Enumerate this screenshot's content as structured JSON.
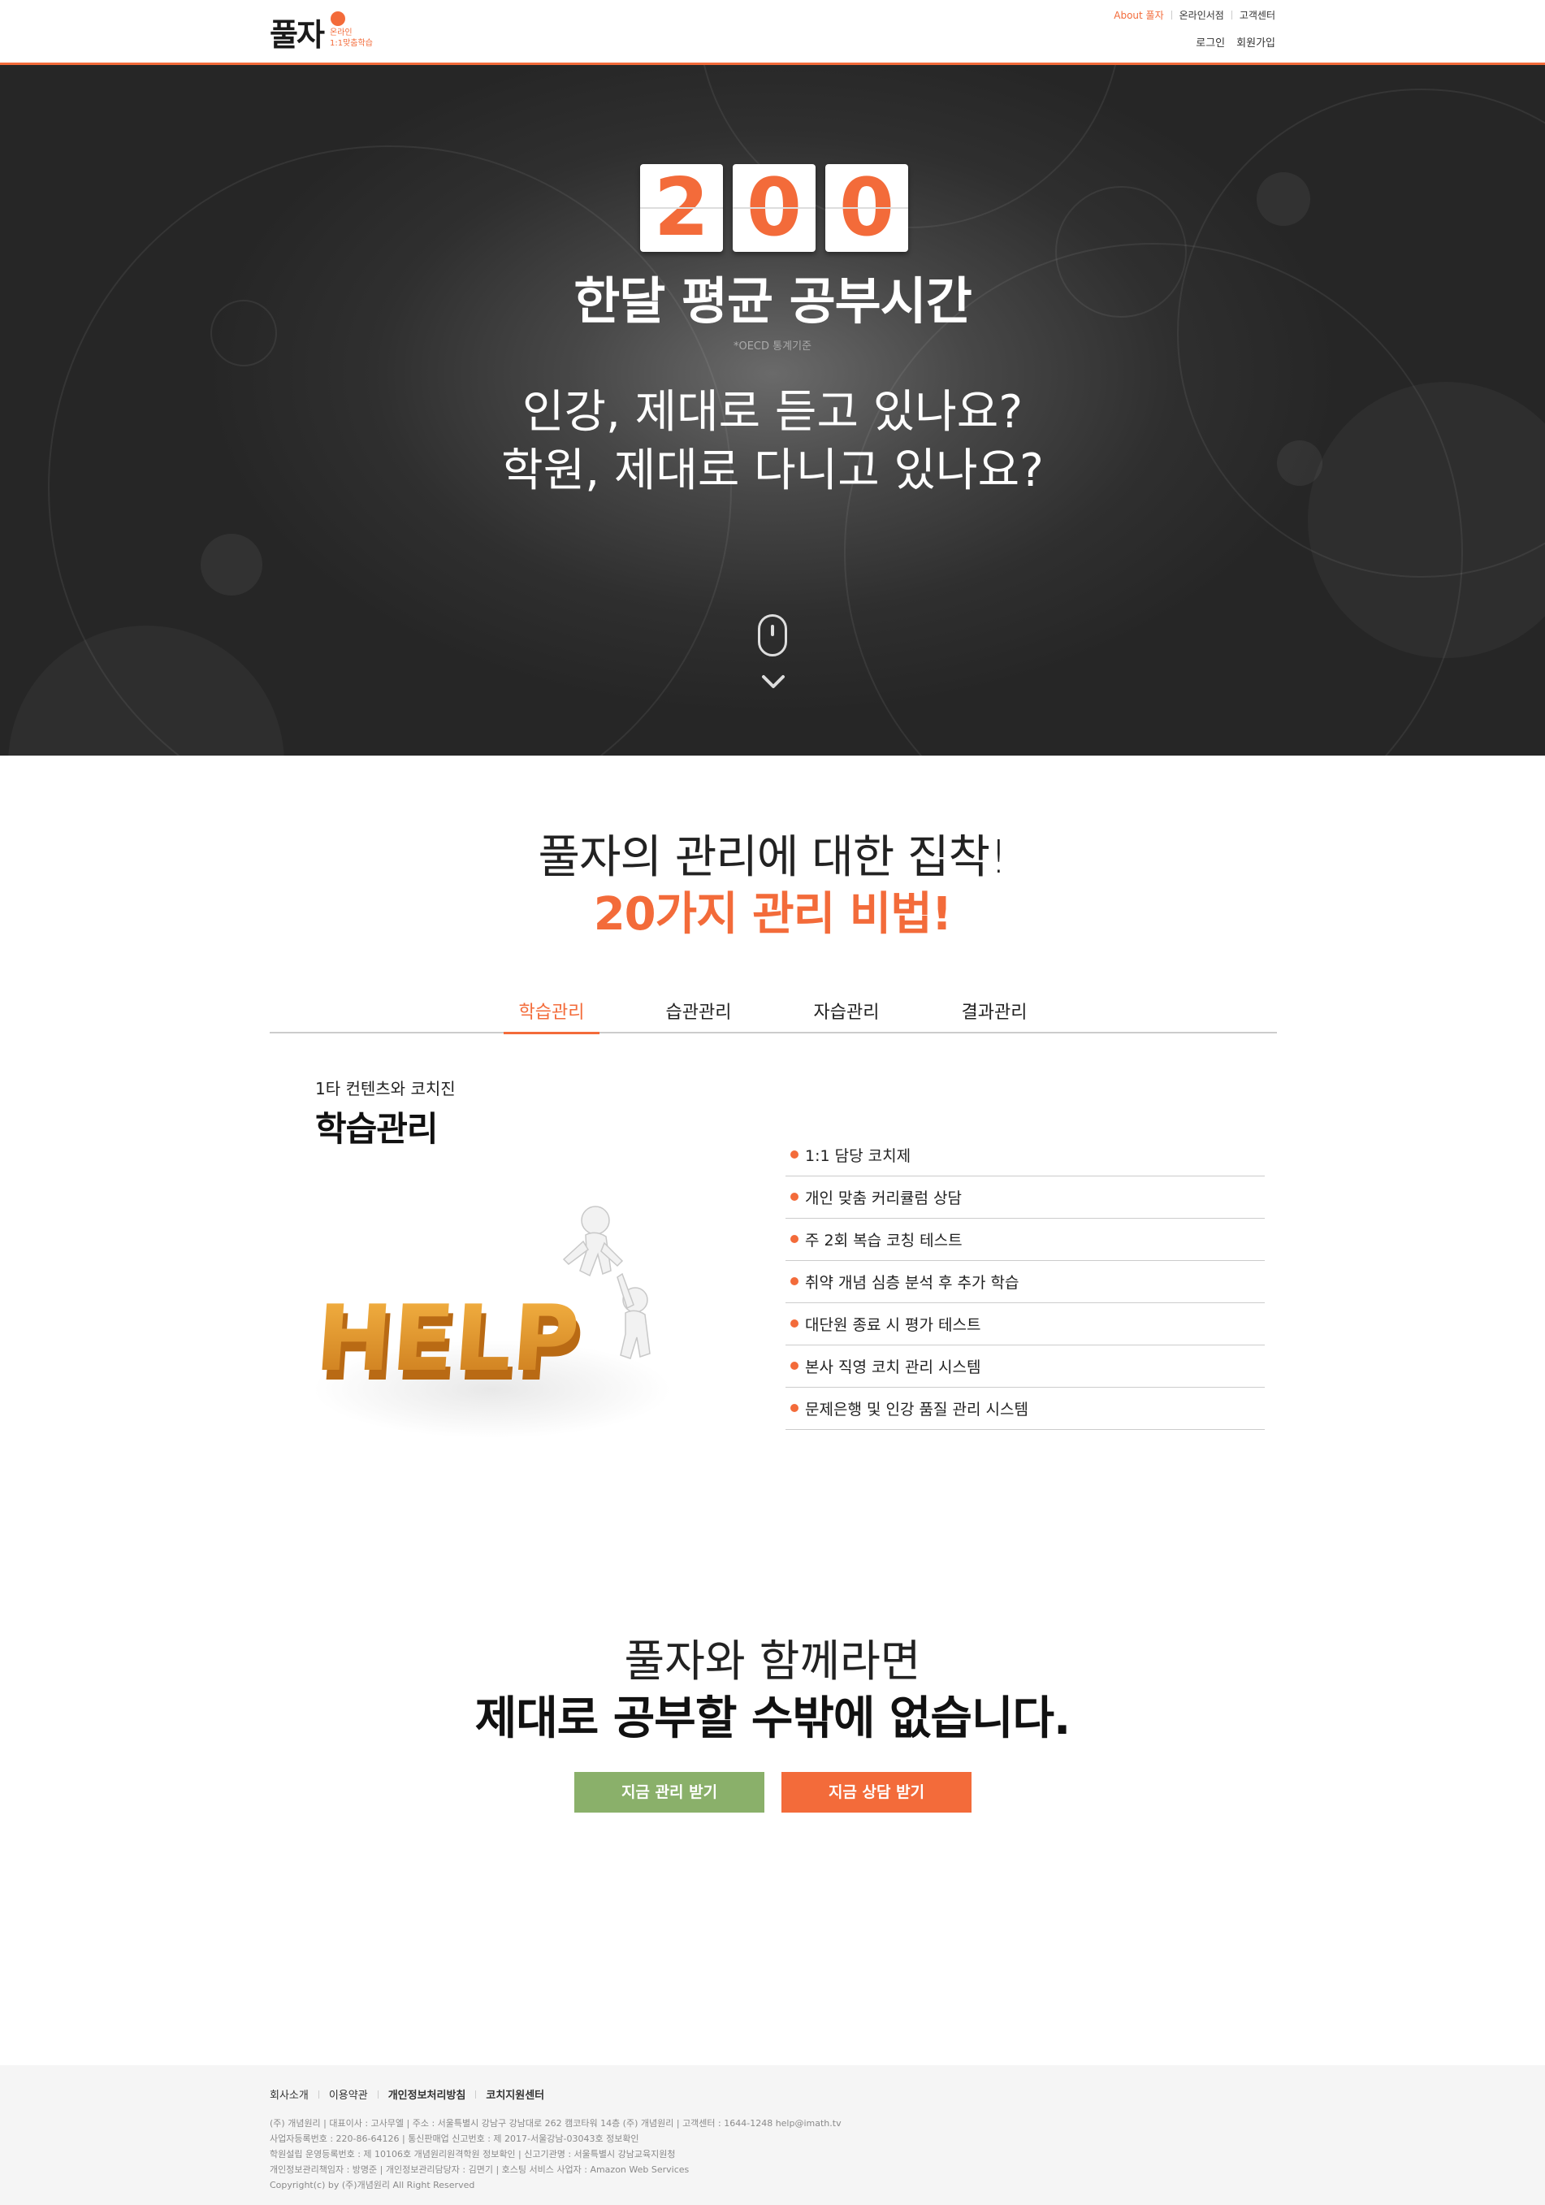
{
  "header": {
    "logo_main": "풀자",
    "logo_sub_1": "온라인",
    "logo_sub_2": "1:1맞춤학습",
    "util_links": [
      "About 풀자",
      "온라인서점",
      "고객센터"
    ],
    "auth_links": [
      "로그인",
      "회원가입"
    ],
    "accent_color": "#f36b3a"
  },
  "hero": {
    "digits": [
      "2",
      "0",
      "0"
    ],
    "title": "한달 평균 공부시간",
    "note": "*OECD 통계기준",
    "question_1": "인강, 제대로 듣고 있나요?",
    "question_2": "학원, 제대로 다니고 있나요?",
    "scroll_icons": [
      "mouse-icon",
      "chevron-down-icon"
    ]
  },
  "section_secrets": {
    "title": "풀자의 관리에 대한 집착!",
    "subtitle": "20가지 관리 비법!",
    "tabs": [
      "학습관리",
      "습관관리",
      "자습관리",
      "결과관리"
    ],
    "active_tab": "학습관리",
    "card": {
      "kicker": "1타 컨텐츠와 코치진",
      "title": "학습관리",
      "image_word": "HELP",
      "features": [
        "1:1 담당 코치제",
        "개인 맞춤 커리큘럼 상담",
        "주 2회 복습 코칭 테스트",
        "취약 개념 심층 분석 후 추가 학습",
        "대단원 종료 시 평가 테스트",
        "본사 직영 코치 관리 시스템",
        "문제은행 및 인강 품질 관리 시스템"
      ]
    }
  },
  "section_cta": {
    "line_1": "풀자와 함께라면",
    "line_2": "제대로 공부할 수밖에 없습니다.",
    "btn_manage": "지금 관리 받기",
    "btn_consult": "지금 상담 받기",
    "btn_manage_color": "#8ab06a",
    "btn_consult_color": "#f36b3a"
  },
  "footer": {
    "links": [
      "회사소개",
      "이용약관",
      "개인정보처리방침",
      "코치지원센터"
    ],
    "info_lines": [
      "(주) 개념원리 | 대표이사 : 고사무엘 | 주소 : 서울특별시 강남구 강남대로 262 캠코타워 14층 (주) 개념원리 | 고객센터 : 1644-1248   help@imath.tv",
      "사업자등록번호 : 220-86-64126 | 통신판매업 신고번호 : 제 2017-서울강남-03043호 정보확인",
      "학원설립 운영등록번호 : 제 10106호 개념원리원격학원 정보확인 | 신고기관명 : 서울특별시 강남교육지원청",
      "개인정보관리책임자 : 방명준 | 개인정보관리담당자 : 김면기 | 호스팅 서비스 사업자 : Amazon Web Services",
      "Copyright(c) by (주)개념원리 All Right Reserved"
    ]
  }
}
